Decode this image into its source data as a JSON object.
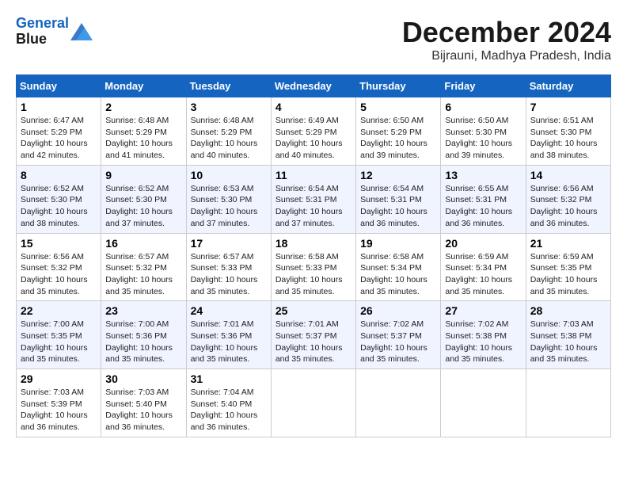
{
  "header": {
    "logo_line1": "General",
    "logo_line2": "Blue",
    "month_title": "December 2024",
    "location": "Bijrauni, Madhya Pradesh, India"
  },
  "weekdays": [
    "Sunday",
    "Monday",
    "Tuesday",
    "Wednesday",
    "Thursday",
    "Friday",
    "Saturday"
  ],
  "weeks": [
    [
      {
        "day": "1",
        "sunrise": "6:47 AM",
        "sunset": "5:29 PM",
        "daylight": "10 hours and 42 minutes."
      },
      {
        "day": "2",
        "sunrise": "6:48 AM",
        "sunset": "5:29 PM",
        "daylight": "10 hours and 41 minutes."
      },
      {
        "day": "3",
        "sunrise": "6:48 AM",
        "sunset": "5:29 PM",
        "daylight": "10 hours and 40 minutes."
      },
      {
        "day": "4",
        "sunrise": "6:49 AM",
        "sunset": "5:29 PM",
        "daylight": "10 hours and 40 minutes."
      },
      {
        "day": "5",
        "sunrise": "6:50 AM",
        "sunset": "5:29 PM",
        "daylight": "10 hours and 39 minutes."
      },
      {
        "day": "6",
        "sunrise": "6:50 AM",
        "sunset": "5:30 PM",
        "daylight": "10 hours and 39 minutes."
      },
      {
        "day": "7",
        "sunrise": "6:51 AM",
        "sunset": "5:30 PM",
        "daylight": "10 hours and 38 minutes."
      }
    ],
    [
      {
        "day": "8",
        "sunrise": "6:52 AM",
        "sunset": "5:30 PM",
        "daylight": "10 hours and 38 minutes."
      },
      {
        "day": "9",
        "sunrise": "6:52 AM",
        "sunset": "5:30 PM",
        "daylight": "10 hours and 37 minutes."
      },
      {
        "day": "10",
        "sunrise": "6:53 AM",
        "sunset": "5:30 PM",
        "daylight": "10 hours and 37 minutes."
      },
      {
        "day": "11",
        "sunrise": "6:54 AM",
        "sunset": "5:31 PM",
        "daylight": "10 hours and 37 minutes."
      },
      {
        "day": "12",
        "sunrise": "6:54 AM",
        "sunset": "5:31 PM",
        "daylight": "10 hours and 36 minutes."
      },
      {
        "day": "13",
        "sunrise": "6:55 AM",
        "sunset": "5:31 PM",
        "daylight": "10 hours and 36 minutes."
      },
      {
        "day": "14",
        "sunrise": "6:56 AM",
        "sunset": "5:32 PM",
        "daylight": "10 hours and 36 minutes."
      }
    ],
    [
      {
        "day": "15",
        "sunrise": "6:56 AM",
        "sunset": "5:32 PM",
        "daylight": "10 hours and 35 minutes."
      },
      {
        "day": "16",
        "sunrise": "6:57 AM",
        "sunset": "5:32 PM",
        "daylight": "10 hours and 35 minutes."
      },
      {
        "day": "17",
        "sunrise": "6:57 AM",
        "sunset": "5:33 PM",
        "daylight": "10 hours and 35 minutes."
      },
      {
        "day": "18",
        "sunrise": "6:58 AM",
        "sunset": "5:33 PM",
        "daylight": "10 hours and 35 minutes."
      },
      {
        "day": "19",
        "sunrise": "6:58 AM",
        "sunset": "5:34 PM",
        "daylight": "10 hours and 35 minutes."
      },
      {
        "day": "20",
        "sunrise": "6:59 AM",
        "sunset": "5:34 PM",
        "daylight": "10 hours and 35 minutes."
      },
      {
        "day": "21",
        "sunrise": "6:59 AM",
        "sunset": "5:35 PM",
        "daylight": "10 hours and 35 minutes."
      }
    ],
    [
      {
        "day": "22",
        "sunrise": "7:00 AM",
        "sunset": "5:35 PM",
        "daylight": "10 hours and 35 minutes."
      },
      {
        "day": "23",
        "sunrise": "7:00 AM",
        "sunset": "5:36 PM",
        "daylight": "10 hours and 35 minutes."
      },
      {
        "day": "24",
        "sunrise": "7:01 AM",
        "sunset": "5:36 PM",
        "daylight": "10 hours and 35 minutes."
      },
      {
        "day": "25",
        "sunrise": "7:01 AM",
        "sunset": "5:37 PM",
        "daylight": "10 hours and 35 minutes."
      },
      {
        "day": "26",
        "sunrise": "7:02 AM",
        "sunset": "5:37 PM",
        "daylight": "10 hours and 35 minutes."
      },
      {
        "day": "27",
        "sunrise": "7:02 AM",
        "sunset": "5:38 PM",
        "daylight": "10 hours and 35 minutes."
      },
      {
        "day": "28",
        "sunrise": "7:03 AM",
        "sunset": "5:38 PM",
        "daylight": "10 hours and 35 minutes."
      }
    ],
    [
      {
        "day": "29",
        "sunrise": "7:03 AM",
        "sunset": "5:39 PM",
        "daylight": "10 hours and 36 minutes."
      },
      {
        "day": "30",
        "sunrise": "7:03 AM",
        "sunset": "5:40 PM",
        "daylight": "10 hours and 36 minutes."
      },
      {
        "day": "31",
        "sunrise": "7:04 AM",
        "sunset": "5:40 PM",
        "daylight": "10 hours and 36 minutes."
      },
      null,
      null,
      null,
      null
    ]
  ],
  "labels": {
    "sunrise": "Sunrise:",
    "sunset": "Sunset:",
    "daylight": "Daylight:"
  }
}
